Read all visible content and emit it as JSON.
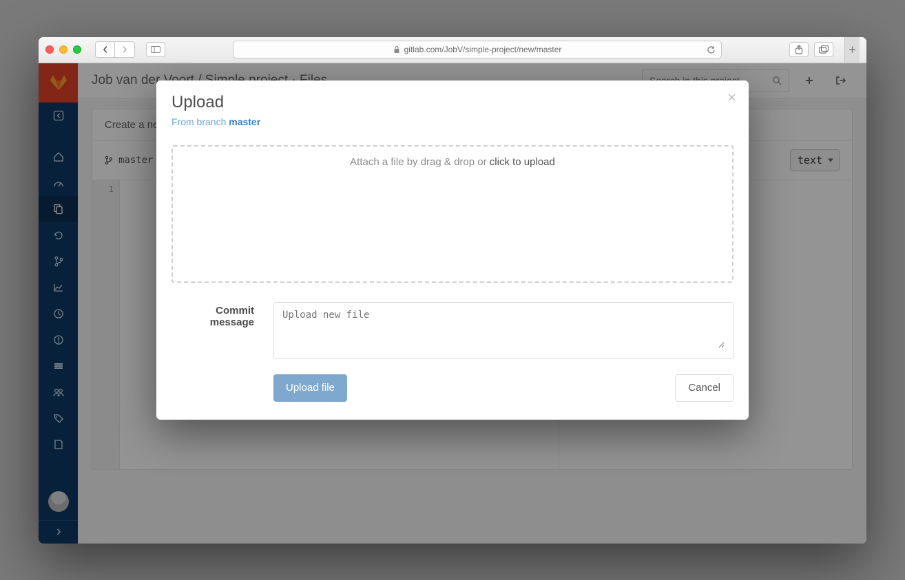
{
  "browser": {
    "url_display": "gitlab.com/JobV/simple-project/new/master"
  },
  "header": {
    "breadcrumb": "Job van der Voort / Simple project · Files",
    "search_placeholder": "Search in this project"
  },
  "page": {
    "create_heading": "Create a new",
    "branch_label": "master",
    "line_number": "1",
    "format_selected": "text"
  },
  "modal": {
    "title": "Upload",
    "branch_prefix": "From branch ",
    "branch_name": "master",
    "dropzone_prefix": "Attach a file by drag & drop or ",
    "dropzone_link": "click to upload",
    "commit_label": "Commit message",
    "commit_placeholder": "Upload new file",
    "upload_btn": "Upload file",
    "cancel_btn": "Cancel"
  }
}
